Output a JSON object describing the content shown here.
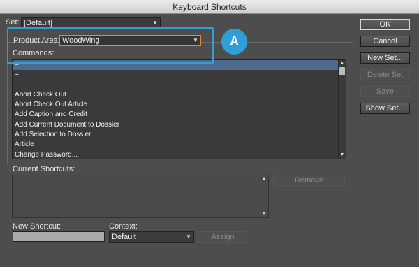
{
  "window": {
    "title": "Keyboard Shortcuts"
  },
  "set": {
    "label": "Set:",
    "value": "[Default]"
  },
  "product_area": {
    "label": "Product Area:",
    "value": "WoodWing"
  },
  "commands": {
    "label": "Commands:",
    "items": [
      "–",
      "–",
      "–",
      "Abort Check Out",
      "Abort Check Out Article",
      "Add Caption and Credit",
      "Add Current Document to Dossier",
      "Add Selection to Dossier",
      "Article",
      "Change Password..."
    ]
  },
  "current_shortcuts": {
    "label": "Current Shortcuts:"
  },
  "new_shortcut": {
    "label": "New Shortcut:",
    "value": ""
  },
  "context": {
    "label": "Context:",
    "value": "Default"
  },
  "buttons": {
    "ok": "OK",
    "cancel": "Cancel",
    "new_set": "New Set...",
    "delete_set": "Delete Set",
    "save": "Save",
    "show_set": "Show Set...",
    "remove": "Remove",
    "assign": "Assign"
  },
  "callout": {
    "badge": "A",
    "color": "#2f9fd6"
  },
  "colors": {
    "dialog_bg": "#4d4d4d",
    "selection": "#4f6a8f",
    "focus_border": "#e88a2a"
  }
}
